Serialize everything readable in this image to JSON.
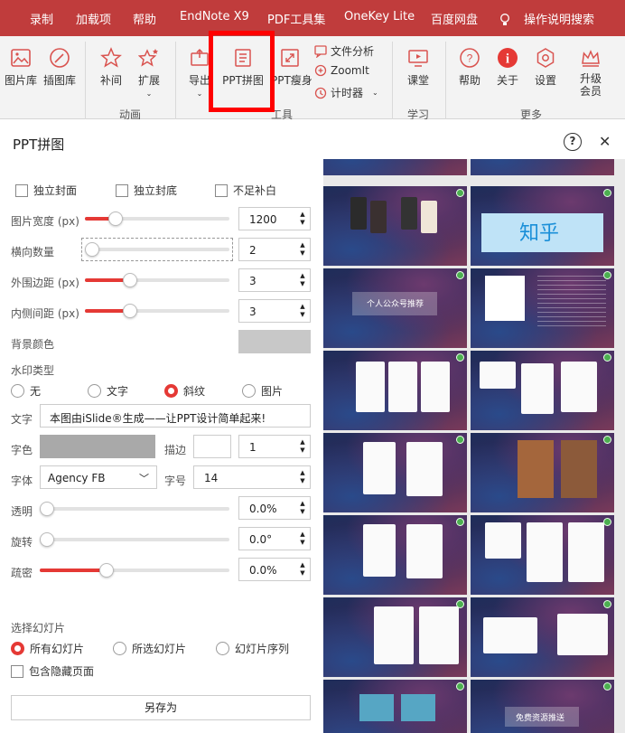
{
  "menu": [
    "录制",
    "加载项",
    "帮助",
    "EndNote X9",
    "PDF工具集",
    "OneKey Lite",
    "百度网盘",
    "操作说明搜索"
  ],
  "ribbon": {
    "buttons": [
      "图片库",
      "插图库",
      "补间",
      "扩展",
      "导出",
      "PPT拼图",
      "PPT瘦身",
      "课堂",
      "帮助",
      "关于",
      "设置",
      "升级\n会员"
    ],
    "small": [
      "文件分析",
      "ZoomIt",
      "计时器"
    ],
    "groups": [
      "动画",
      "工具",
      "学习",
      "更多"
    ]
  },
  "dialog": {
    "title": "PPT拼图",
    "help": "?",
    "close": "✕"
  },
  "options": {
    "checks": [
      "独立封面",
      "独立封底",
      "不足补白"
    ],
    "image_width_label": "图片宽度 (px)",
    "image_width": "1200",
    "columns_label": "横向数量",
    "columns": "2",
    "outer_margin_label": "外围边距 (px)",
    "outer_margin": "3",
    "inner_gap_label": "内侧间距 (px)",
    "inner_gap": "3",
    "bg_color_label": "背景颜色",
    "watermark_type_label": "水印类型",
    "watermark_types": [
      "无",
      "文字",
      "斜纹",
      "图片"
    ],
    "selected_watermark": "斜纹",
    "text_label": "文字",
    "text_value": "本图由iSlide®生成——让PPT设计简单起来!",
    "font_color_label": "字色",
    "stroke_label": "描边",
    "stroke_value": "1",
    "font_label": "字体",
    "font_value": "Agency FB",
    "font_size_label": "字号",
    "font_size_value": "14",
    "opacity_label": "透明",
    "opacity_value": "0.0%",
    "rotation_label": "旋转",
    "rotation_value": "0.0°",
    "density_label": "疏密",
    "density_value": "0.0%",
    "select_slides_label": "选择幻灯片",
    "slide_options": [
      "所有幻灯片",
      "所选幻灯片",
      "幻灯片序列"
    ],
    "selected_slide_option": "所有幻灯片",
    "include_hidden": "包含隐藏页面",
    "save_as": "另存为"
  },
  "preview": {
    "slide_texts": [
      "个人公众号推荐",
      "知乎",
      "免费资源推送"
    ]
  },
  "colors": {
    "menubar": "#c03c3c",
    "accent": "#e53935",
    "highlight_box": "#ff0000",
    "bg_swatch": "#c8c8c8",
    "font_color_swatch": "#a9a9a9"
  }
}
